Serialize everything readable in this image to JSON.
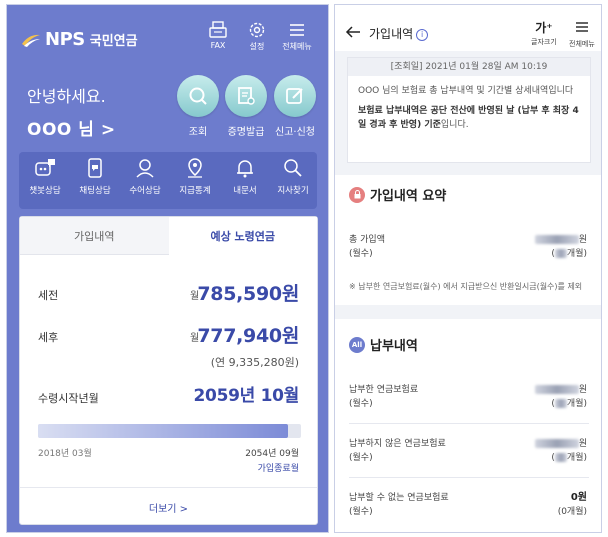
{
  "left": {
    "logo_en": "NPS",
    "logo_ko": "국민연금",
    "top_icons": [
      {
        "icon": "fax-icon",
        "label": "FAX"
      },
      {
        "icon": "gear-icon",
        "label": "설정"
      },
      {
        "icon": "menu-icon",
        "label": "전체메뉴"
      }
    ],
    "greeting": "안녕하세요.",
    "user_name": "OOO 님 >",
    "big_buttons": [
      {
        "icon": "search-icon",
        "label": "조회"
      },
      {
        "icon": "certificate-icon",
        "label": "증명발급"
      },
      {
        "icon": "edit-icon",
        "label": "신고·신청"
      }
    ],
    "quick_menu": [
      {
        "icon": "chatbot-icon",
        "label": "챗봇상담"
      },
      {
        "icon": "chat-icon",
        "label": "채팅상담"
      },
      {
        "icon": "sign-language-icon",
        "label": "수어상담"
      },
      {
        "icon": "location-icon",
        "label": "지급통계"
      },
      {
        "icon": "bell-icon",
        "label": "내문서"
      },
      {
        "icon": "magnifier-icon",
        "label": "지사찾기"
      }
    ],
    "tabs": [
      "가입내역",
      "예상 노령연금"
    ],
    "rows": {
      "pre_tax_label": "세전",
      "unit": "월",
      "pre_tax_amount": "785,590원",
      "post_tax_label": "세후",
      "post_tax_amount": "777,940원",
      "annual": "(연 9,335,280원)",
      "start_label": "수령시작년월",
      "start_value": "2059년 10월"
    },
    "progress": {
      "fraction": 0.95,
      "start": "2018년 03월",
      "end": "2054년 09월",
      "end_link": "가입종료월"
    },
    "more": "더보기 >"
  },
  "right": {
    "title": "가입내역",
    "info": "i",
    "font_size_label": "글자크기",
    "font_size_glyph": "가⁺",
    "menu_label": "전체메뉴",
    "notice": {
      "date": "[조회일] 2021년 01월 28일 AM 10:19",
      "text1": "OOO 님의 보험료 총 납부내역 및 기간별 상세내역입니다",
      "text2_bold": "보험료 납부내역은 공단 전산에 반영된 날 (납부 후 최장 4일 경과 후 반영) 기준",
      "text2_tail": "입니다."
    },
    "summary": {
      "title": "가입내역 요약",
      "row_label1": "총 가입액",
      "row_label2": "(월수)",
      "unit_won": "원",
      "unit_month": "개월)",
      "note": "※ 납부한 연금보험료(월수) 에서 지급받으신 반환일시금(월수)를 제외"
    },
    "payments": {
      "title": "납부내역",
      "icon_text": "All",
      "rows": [
        {
          "label": "납부한 연금보험료",
          "months_label": "(월수)",
          "amount": "원",
          "months": "개월)"
        },
        {
          "label": "납부하지 않은 연금보험료",
          "months_label": "(월수)",
          "amount": "원",
          "months": "개월)"
        },
        {
          "label": "납부할 수 없는 연금보험료",
          "months_label": "(월수)",
          "amount": "0원",
          "months": "(0개월)"
        }
      ]
    }
  }
}
